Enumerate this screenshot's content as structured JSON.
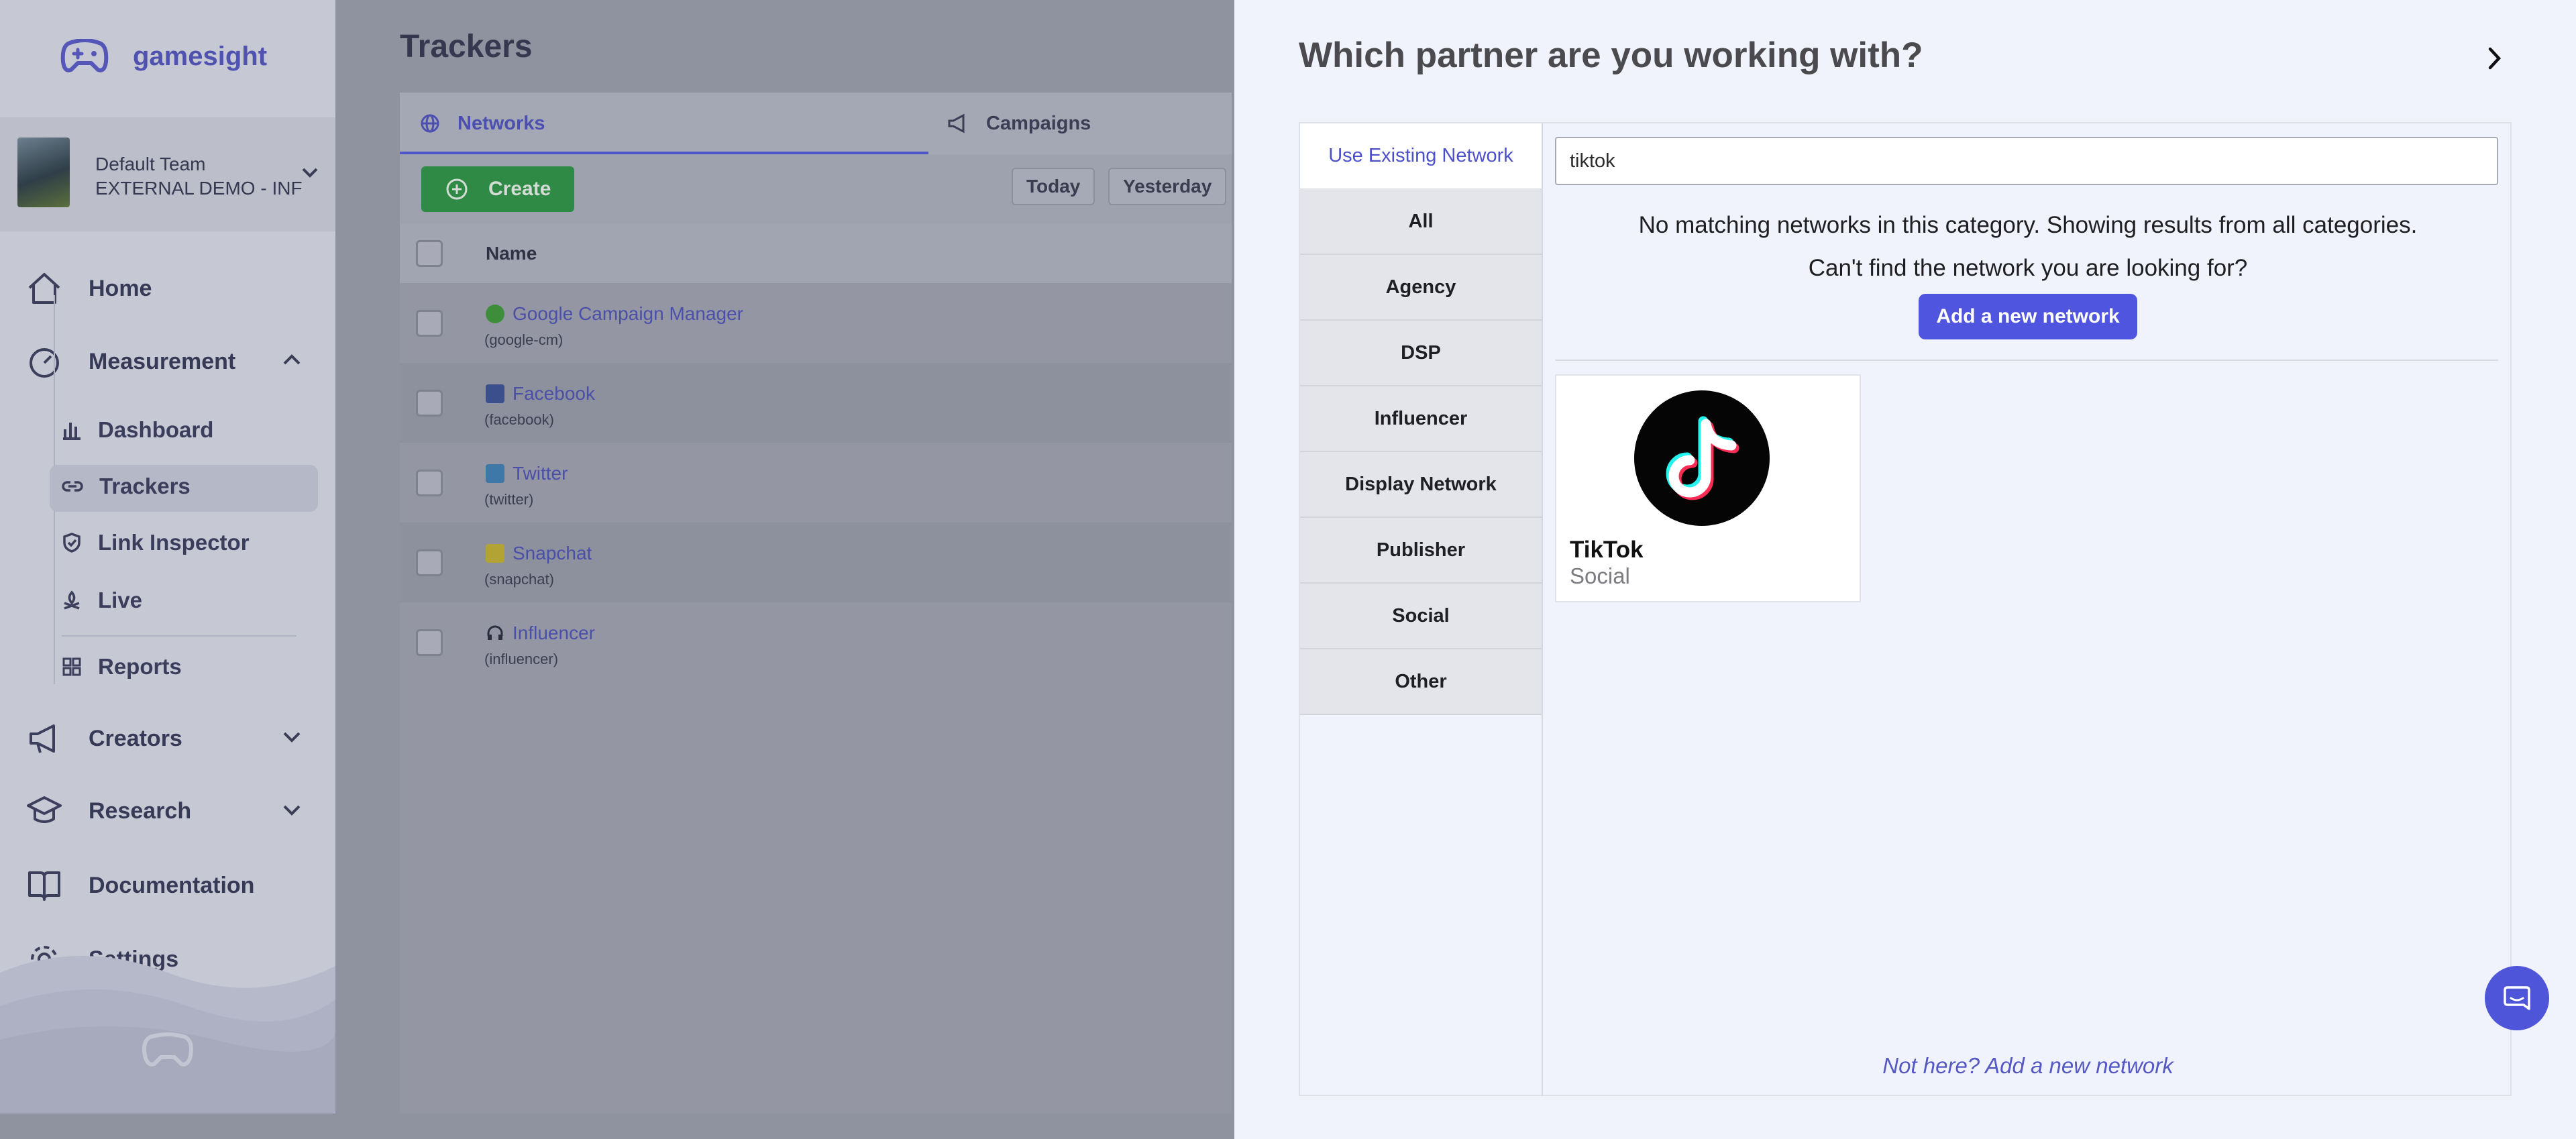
{
  "app": {
    "name": "gamesight"
  },
  "team": {
    "name": "Default Team",
    "org": "EXTERNAL DEMO - INF"
  },
  "sidebar": {
    "items": [
      {
        "label": "Home"
      },
      {
        "label": "Measurement"
      },
      {
        "label": "Creators"
      },
      {
        "label": "Research"
      },
      {
        "label": "Documentation"
      },
      {
        "label": "Settings"
      }
    ],
    "measurement_sub": [
      {
        "label": "Dashboard"
      },
      {
        "label": "Trackers"
      },
      {
        "label": "Link Inspector"
      },
      {
        "label": "Live"
      },
      {
        "label": "Reports"
      }
    ]
  },
  "main": {
    "title": "Trackers",
    "tabs": [
      {
        "label": "Networks"
      },
      {
        "label": "Campaigns"
      }
    ],
    "create_label": "Create",
    "date_buttons": [
      {
        "label": "Today"
      },
      {
        "label": "Yesterday"
      }
    ],
    "table": {
      "header": {
        "name": "Name"
      },
      "rows": [
        {
          "name": "Google Campaign Manager",
          "id": "(google-cm)"
        },
        {
          "name": "Facebook",
          "id": "(facebook)"
        },
        {
          "name": "Twitter",
          "id": "(twitter)"
        },
        {
          "name": "Snapchat",
          "id": "(snapchat)"
        },
        {
          "name": "Influencer",
          "id": "(influencer)"
        }
      ]
    }
  },
  "panel": {
    "title": "Which partner are you working with?",
    "tab_label": "Use Existing Network",
    "categories": [
      {
        "label": "All"
      },
      {
        "label": "Agency"
      },
      {
        "label": "DSP"
      },
      {
        "label": "Influencer"
      },
      {
        "label": "Display Network"
      },
      {
        "label": "Publisher"
      },
      {
        "label": "Social"
      },
      {
        "label": "Other"
      }
    ],
    "search": {
      "value": "tiktok"
    },
    "no_match_msg": "No matching networks in this category. Showing results from all categories.",
    "cant_find_msg": "Can't find the network you are looking for?",
    "add_button_label": "Add a new network",
    "results": [
      {
        "name": "TikTok",
        "category": "Social"
      }
    ],
    "footer_link": "Not here? Add a new network"
  },
  "colors": {
    "accent": "#5055e0",
    "create_green": "#2f8a46",
    "link": "#4a4fa8"
  }
}
